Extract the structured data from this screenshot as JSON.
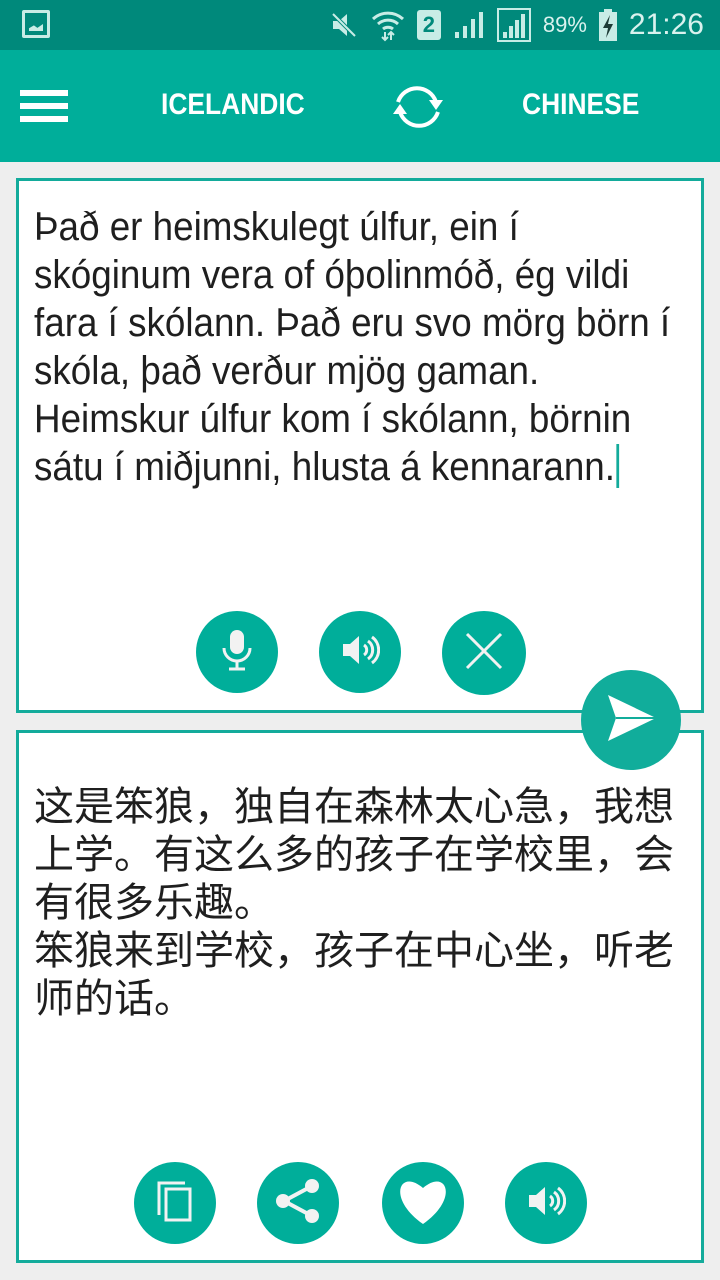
{
  "status_bar": {
    "icons": [
      "gallery-icon",
      "mute-icon",
      "wifi-icon",
      "sim2-icon",
      "signal-icon",
      "signal-icon-2",
      "battery-charging-icon"
    ],
    "sim_label": "2",
    "battery": "89%",
    "time": "21:26"
  },
  "app_bar": {
    "menu_icon": "hamburger-menu-icon",
    "source_language": "ICELANDIC",
    "swap_icon": "swap-languages-icon",
    "target_language": "CHINESE"
  },
  "source_panel": {
    "text": "Það er heimskulegt úlfur, ein í skóginum vera of óþolinmóð, ég vildi fara í skólann. Það eru svo mörg börn í skóla, það verður mjög gaman.\nHeimskur úlfur kom í skólann, börnin sátu í miðjunni, hlusta á kennarann.",
    "buttons": [
      {
        "name": "microphone-button",
        "icon": "microphone-icon"
      },
      {
        "name": "speak-source-button",
        "icon": "speaker-icon"
      },
      {
        "name": "clear-button",
        "icon": "close-icon"
      }
    ]
  },
  "translate_button": {
    "icon": "send-icon"
  },
  "target_panel": {
    "text": "这是笨狼，独自在森林太心急，我想上学。有这么多的孩子在学校里，会有很多乐趣。\n笨狼来到学校，孩子在中心坐，听老师的话。",
    "buttons": [
      {
        "name": "copy-button",
        "icon": "copy-icon"
      },
      {
        "name": "share-button",
        "icon": "share-icon"
      },
      {
        "name": "favorite-button",
        "icon": "heart-icon"
      },
      {
        "name": "speak-target-button",
        "icon": "speaker-icon"
      }
    ]
  },
  "colors": {
    "status_bar": "#00897b",
    "app_bar": "#00ae9a",
    "accent": "#13ab9b",
    "background": "#eeeeee"
  }
}
